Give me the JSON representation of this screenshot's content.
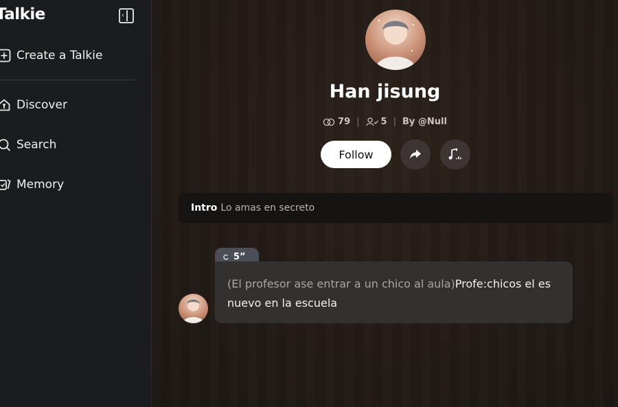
{
  "app": {
    "logo_text": "Talkie"
  },
  "sidebar": {
    "items": [
      {
        "label": "Create a Talkie",
        "icon": "plus-square-icon"
      },
      {
        "label": "Discover",
        "icon": "home-t-icon"
      },
      {
        "label": "Search",
        "icon": "search-icon"
      },
      {
        "label": "Memory",
        "icon": "cards-icon"
      }
    ],
    "collapse_icon": "sidebar-collapse-icon"
  },
  "profile": {
    "name": "Han jisung",
    "chats_count": "79",
    "followers_count": "5",
    "author": "By @Null",
    "follow_label": "Follow",
    "share_icon": "share-arrow-icon",
    "music_icon": "music-note-icon"
  },
  "intro": {
    "label": "Intro",
    "text": "Lo amas en secreto"
  },
  "message": {
    "duration": "5”",
    "narration": "(El profesor ase entrar a un chico al aula)",
    "speech": "Profe:chicos el es nuevo en la escuela"
  },
  "colors": {
    "sidebar_bg": "#1b1c1f",
    "bubble_bg": "#333130",
    "chip_bg": "#4b4e57",
    "accent_button": "#ffffff"
  }
}
